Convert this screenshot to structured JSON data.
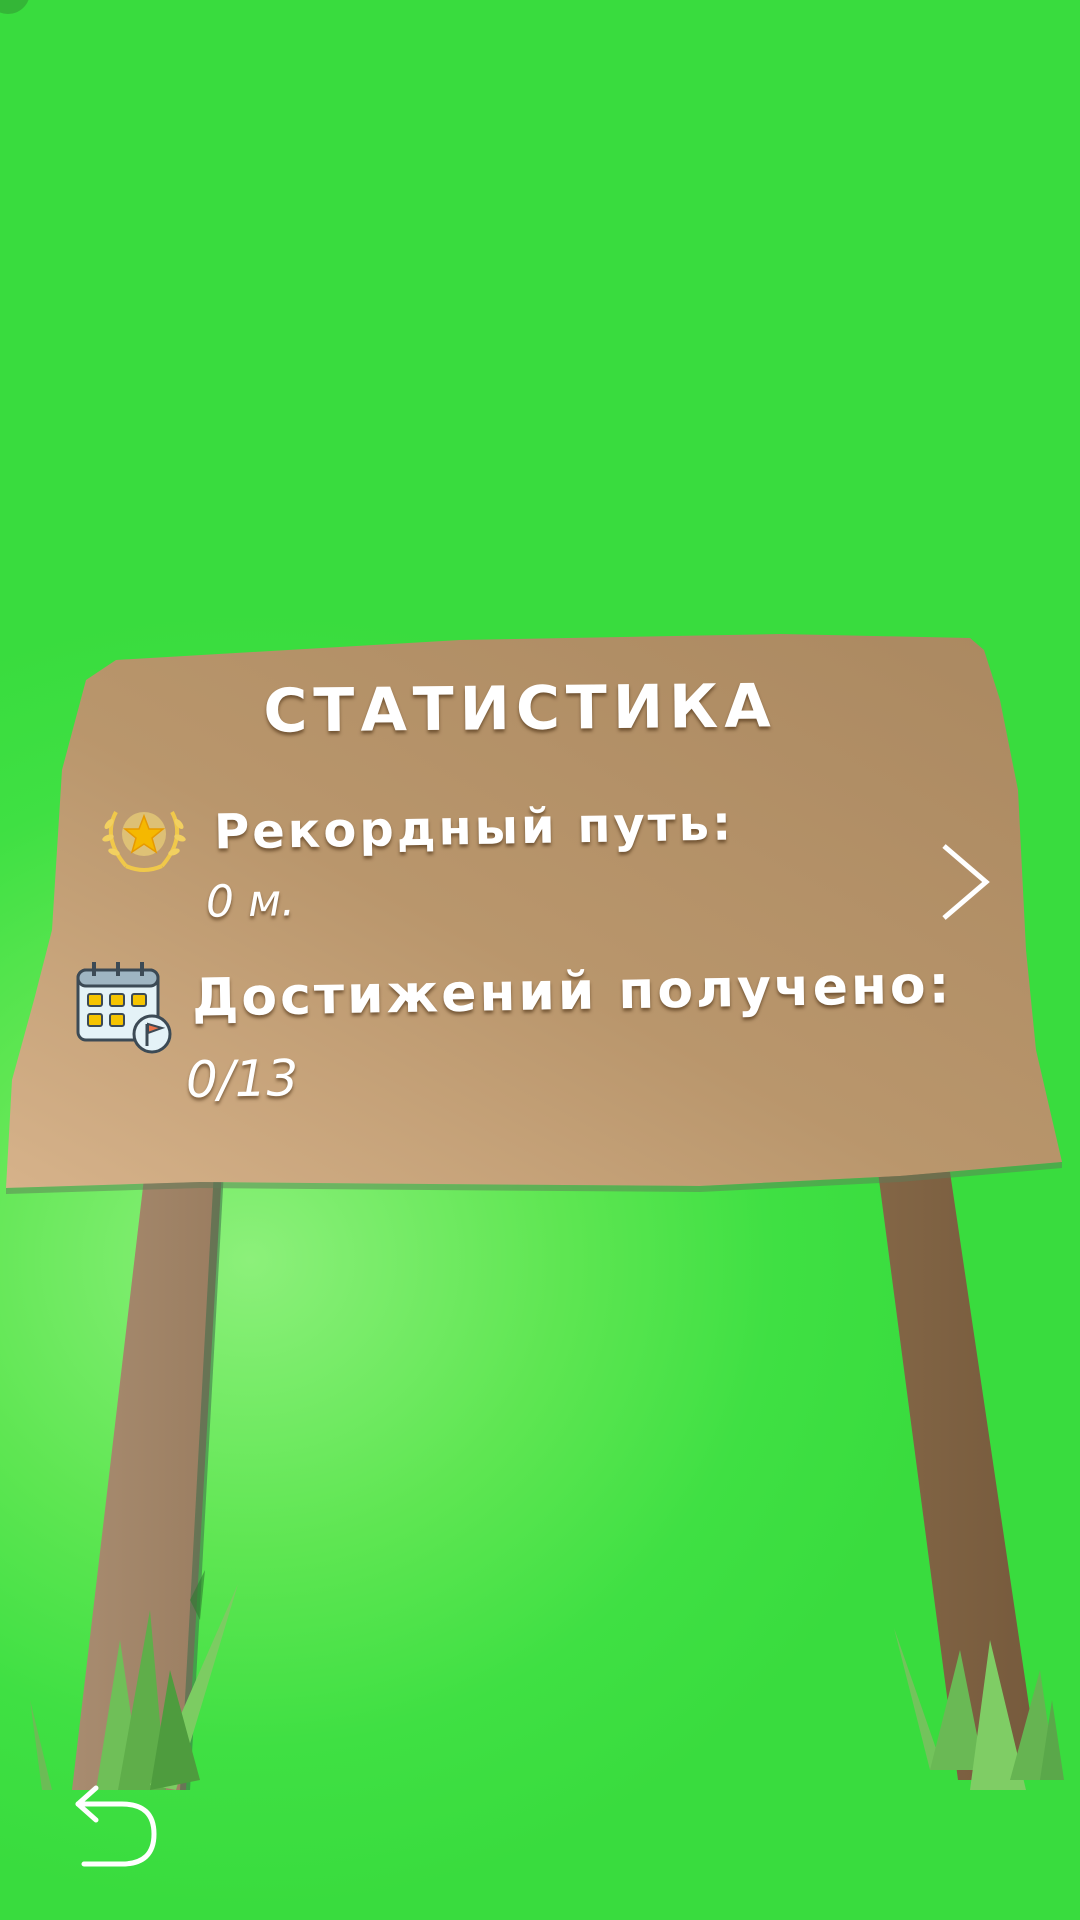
{
  "sign": {
    "title": "СТАТИСТИКА",
    "record": {
      "label": "Рекордный путь:",
      "value": "0 м.",
      "icon": "laurel-star-icon"
    },
    "achievements": {
      "label": "Достижений получено:",
      "value": "0/13",
      "icon": "calendar-flag-icon"
    }
  },
  "controls": {
    "next_icon": "chevron-right-icon",
    "back_icon": "undo-arrow-icon"
  },
  "colors": {
    "grass": "#3fe043",
    "grass_highlight": "#8cf07a",
    "wood_light": "#d3b08a",
    "wood_dark": "#ac8a63",
    "text": "#ffffff"
  }
}
